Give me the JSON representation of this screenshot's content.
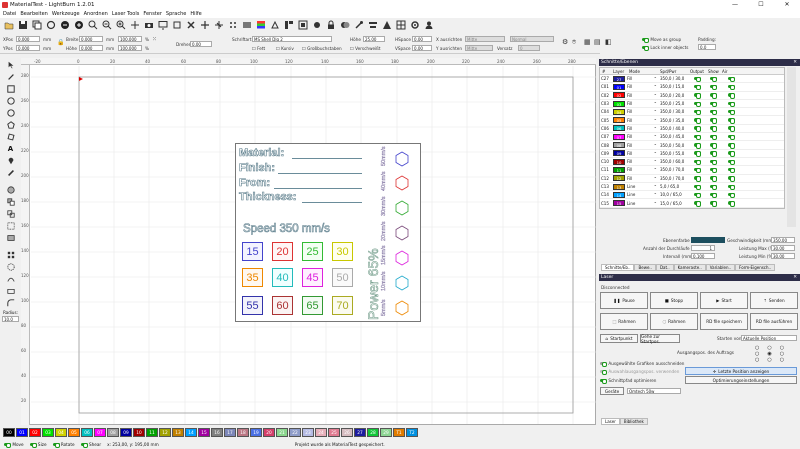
{
  "window": {
    "title": "MaterialTest - LightBurn 1.2.01",
    "minimize": "—",
    "maximize": "☐",
    "close": "✕"
  },
  "menu": [
    "Datei",
    "Bearbeiten",
    "Werkzeuge",
    "Anordnen",
    "Laser Tools",
    "Fenster",
    "Sprache",
    "Hilfe"
  ],
  "toolbar_icons": [
    "open-folder-icon",
    "save-icon",
    "copy-icon",
    "refresh-icon",
    "undo-icon",
    "redo-icon",
    "zoom-in-icon",
    "zoom-out-icon",
    "zoom-window-icon",
    "pan-icon",
    "select-icon",
    "hand-icon",
    "camera-icon",
    "monitor-icon",
    "fit-icon",
    "settings-icon",
    "cross-icon",
    "cross-icon",
    "dots-icon",
    "screen-icon",
    "rainbow-icon",
    "trace-icon",
    "layout-icon",
    "frame-icon",
    "node-icon",
    "frame-icon",
    "lock-icon",
    "boolean-icon",
    "tool-icon",
    "align-icon",
    "shape-icon",
    "grid-icon",
    "gear-icon",
    "user-icon"
  ],
  "props": {
    "xpos_label": "XPos",
    "xpos": "0,000",
    "ypos_label": "YPos",
    "ypos": "0,000",
    "unit": "mm",
    "width_label": "Breite",
    "width": "0,000",
    "height_label": "Höhe",
    "height": "0,000",
    "scale_x": "100,000",
    "scale_y": "100,000",
    "pct": "%",
    "rotate_label": "Drehen",
    "rotate": "0,00",
    "font_label": "Schriftart",
    "font": "MS Shell Dlg 2",
    "bold": "Fett",
    "italic": "Kursiv",
    "caps": "Großbuchstaben",
    "height2_label": "Höhe",
    "height2": "25,00",
    "hspace_label": "HSpace",
    "hspace": "0,00",
    "vspace_label": "VSpace",
    "vspace": "0,00",
    "welded": "Verschweißt",
    "align_x_label": "X ausrichten",
    "align_x": "Mitte",
    "align_y_label": "Y ausrichten",
    "align_y": "Mitte",
    "normal": "Normal",
    "offset_label": "Versatz",
    "offset": "0",
    "move_group": "Move as group",
    "lock_inner": "Lock inner objects",
    "padding_label": "Padding:",
    "padding": "0,0"
  },
  "ruler_top": [
    "-20",
    "0",
    "20",
    "40",
    "60",
    "80",
    "100",
    "120",
    "140",
    "160",
    "180",
    "200",
    "220",
    "240",
    "260",
    "280"
  ],
  "ruler_left": [
    "280",
    "260",
    "240",
    "220",
    "200",
    "180",
    "160",
    "140",
    "120",
    "100",
    "80",
    "60",
    "40",
    "20",
    "0",
    "-20"
  ],
  "card": {
    "material": "Material:",
    "finish": "Finish:",
    "from": "From:",
    "thickness": "Thickness:",
    "speed": "Speed 350 mm/s",
    "powers": [
      [
        "15",
        "20",
        "25",
        "30"
      ],
      [
        "35",
        "40",
        "45",
        "50"
      ],
      [
        "55",
        "60",
        "65",
        "70"
      ]
    ],
    "power_label": "Power 65%",
    "hatch": [
      "5mm/s",
      "10mm/s",
      "15mm/s",
      "20mm/s",
      "30mm/s",
      "40mm/s",
      "50mm/s"
    ]
  },
  "left_tools": [
    "select-arrow-icon",
    "pen-icon",
    "rectangle-icon",
    "ellipse-icon",
    "circle-icon",
    "polygon-icon",
    "star-icon",
    "text-icon",
    "position-icon",
    "measure-icon",
    "offset-icon",
    "boolean-icon",
    "weld-icon",
    "group-icon",
    "align-icon",
    "grid-array-icon",
    "circle-array-icon",
    "node-edit-icon",
    "tab-icon",
    "radius-icon"
  ],
  "radius_label": "Radius:",
  "radius": "10,0",
  "cuts": {
    "title": "Schnitte/Ebenen",
    "headers": [
      "#",
      "Layer",
      "Mode",
      "Spd/Pwr",
      "Output",
      "Show",
      "Air"
    ],
    "rows": [
      {
        "n": "C27",
        "c": "27",
        "col": "#1d1d9f",
        "mode": "Fill",
        "sp": "350,0 / 30,0"
      },
      {
        "n": "C01",
        "c": "01",
        "col": "#0000ff",
        "mode": "Fill",
        "sp": "350,0 / 15,0"
      },
      {
        "n": "C02",
        "c": "02",
        "col": "#ff0000",
        "mode": "Fill",
        "sp": "350,0 / 20,0"
      },
      {
        "n": "C03",
        "c": "03",
        "col": "#00e000",
        "mode": "Fill",
        "sp": "350,0 / 25,0"
      },
      {
        "n": "C04",
        "c": "04",
        "col": "#d0d000",
        "mode": "Fill",
        "sp": "350,0 / 30,0"
      },
      {
        "n": "C05",
        "c": "05",
        "col": "#ff8000",
        "mode": "Fill",
        "sp": "350,0 / 35,0"
      },
      {
        "n": "C06",
        "c": "06",
        "col": "#00c0c0",
        "mode": "Fill",
        "sp": "350,0 / 40,0"
      },
      {
        "n": "C07",
        "c": "07",
        "col": "#ff00ff",
        "mode": "Fill",
        "sp": "350,0 / 45,0"
      },
      {
        "n": "C08",
        "c": "08",
        "col": "#a0a0a0",
        "mode": "Fill",
        "sp": "350,0 / 50,0"
      },
      {
        "n": "C09",
        "c": "09",
        "col": "#0000a0",
        "mode": "Fill",
        "sp": "350,0 / 55,0"
      },
      {
        "n": "C10",
        "c": "10",
        "col": "#a00000",
        "mode": "Fill",
        "sp": "350,0 / 60,0"
      },
      {
        "n": "C11",
        "c": "11",
        "col": "#00a000",
        "mode": "Fill",
        "sp": "350,0 / 70,0"
      },
      {
        "n": "C12",
        "c": "12",
        "col": "#a0a000",
        "mode": "Fill",
        "sp": "350,0 / 70,0"
      },
      {
        "n": "C13",
        "c": "13",
        "col": "#c08000",
        "mode": "Line",
        "sp": "5,0 / 65,0"
      },
      {
        "n": "C14",
        "c": "14",
        "col": "#00a0ff",
        "mode": "Line",
        "sp": "10,0 / 65,0"
      },
      {
        "n": "C15",
        "c": "15",
        "col": "#a000a0",
        "mode": "Line",
        "sp": "15,0 / 65,0"
      }
    ],
    "layer_color_label": "Ebenenfarbe",
    "speed_label": "Geschwindigkeit (mm/s)",
    "speed": "350,00",
    "passes_label": "Anzahl der Durchläufe",
    "passes": "1",
    "power_max_label": "Leistung Max (%)",
    "power_max": "30,00",
    "interval_label": "Intervall (mm)",
    "interval": "0,100",
    "power_min_label": "Leistung Min (%)",
    "power_min": "30,00"
  },
  "right_tabs": [
    "Schnitte/Eb..",
    "Bewe..",
    "Dat..",
    "Kameraste..",
    "Variablen..",
    "Form-Eigensch.."
  ],
  "laser": {
    "title": "Laser",
    "status": "Disconnected",
    "pause": "Pause",
    "stop": "Stopp",
    "start": "Start",
    "send": "Senden",
    "frame1": "Rahmen",
    "frame2": "Rahmen",
    "save_rd": "RD file speichern",
    "run_rd": "RD file ausführen",
    "home": "Startpunkt",
    "goto_origin": "Gehe zur Startpos.",
    "start_from_label": "Starten von:",
    "start_from": "Aktuelle Position",
    "job_origin_label": "Ausgangspos. des Auftrags",
    "cut_selected": "Ausgewählte Grafiken ausschneiden",
    "use_selection_origin": "Auswahlausgangspos. verwenden",
    "show_last_position": "Letzte Position anzeigen",
    "optimize_cut": "Schnittpfad optimieren",
    "optimize_settings": "Optimierungseinstellungen",
    "devices": "Geräte",
    "device": "Omtech 50w"
  },
  "bottom_tabs": [
    "Laser",
    "Bibliothek"
  ],
  "palette": [
    {
      "l": "00",
      "c": "#000000"
    },
    {
      "l": "01",
      "c": "#0000ff"
    },
    {
      "l": "02",
      "c": "#ff0000"
    },
    {
      "l": "03",
      "c": "#00e000"
    },
    {
      "l": "04",
      "c": "#d0d000"
    },
    {
      "l": "05",
      "c": "#ff8000"
    },
    {
      "l": "06",
      "c": "#00c0c0"
    },
    {
      "l": "07",
      "c": "#ff00ff"
    },
    {
      "l": "08",
      "c": "#a0a0a0"
    },
    {
      "l": "09",
      "c": "#0000a0"
    },
    {
      "l": "10",
      "c": "#a00000"
    },
    {
      "l": "11",
      "c": "#00a000"
    },
    {
      "l": "12",
      "c": "#a0a000"
    },
    {
      "l": "13",
      "c": "#c08000"
    },
    {
      "l": "14",
      "c": "#00a0ff"
    },
    {
      "l": "15",
      "c": "#a000a0"
    },
    {
      "l": "16",
      "c": "#808080"
    },
    {
      "l": "17",
      "c": "#7d87b9"
    },
    {
      "l": "18",
      "c": "#bb7784"
    },
    {
      "l": "19",
      "c": "#4a6fe3"
    },
    {
      "l": "20",
      "c": "#d33f6a"
    },
    {
      "l": "21",
      "c": "#8cd78f"
    },
    {
      "l": "22",
      "c": "#8e9cc9"
    },
    {
      "l": "23",
      "c": "#b5bbe3"
    },
    {
      "l": "24",
      "c": "#e6afb9"
    },
    {
      "l": "25",
      "c": "#e07b91"
    },
    {
      "l": "26",
      "c": "#d6bcc0"
    },
    {
      "l": "27",
      "c": "#1d1d9f"
    },
    {
      "l": "28",
      "c": "#11c638"
    },
    {
      "l": "29",
      "c": "#8dd593"
    },
    {
      "l": "T1",
      "c": "#e07b00"
    },
    {
      "l": "T2",
      "c": "#0090e0"
    }
  ],
  "status": {
    "move": "Move",
    "size": "Size",
    "rotate": "Rotate",
    "shear": "Shear",
    "coords": "x: 253,00, y: 195,00 mm",
    "message": "Projekt wurde als MaterialTest gespeichert."
  }
}
